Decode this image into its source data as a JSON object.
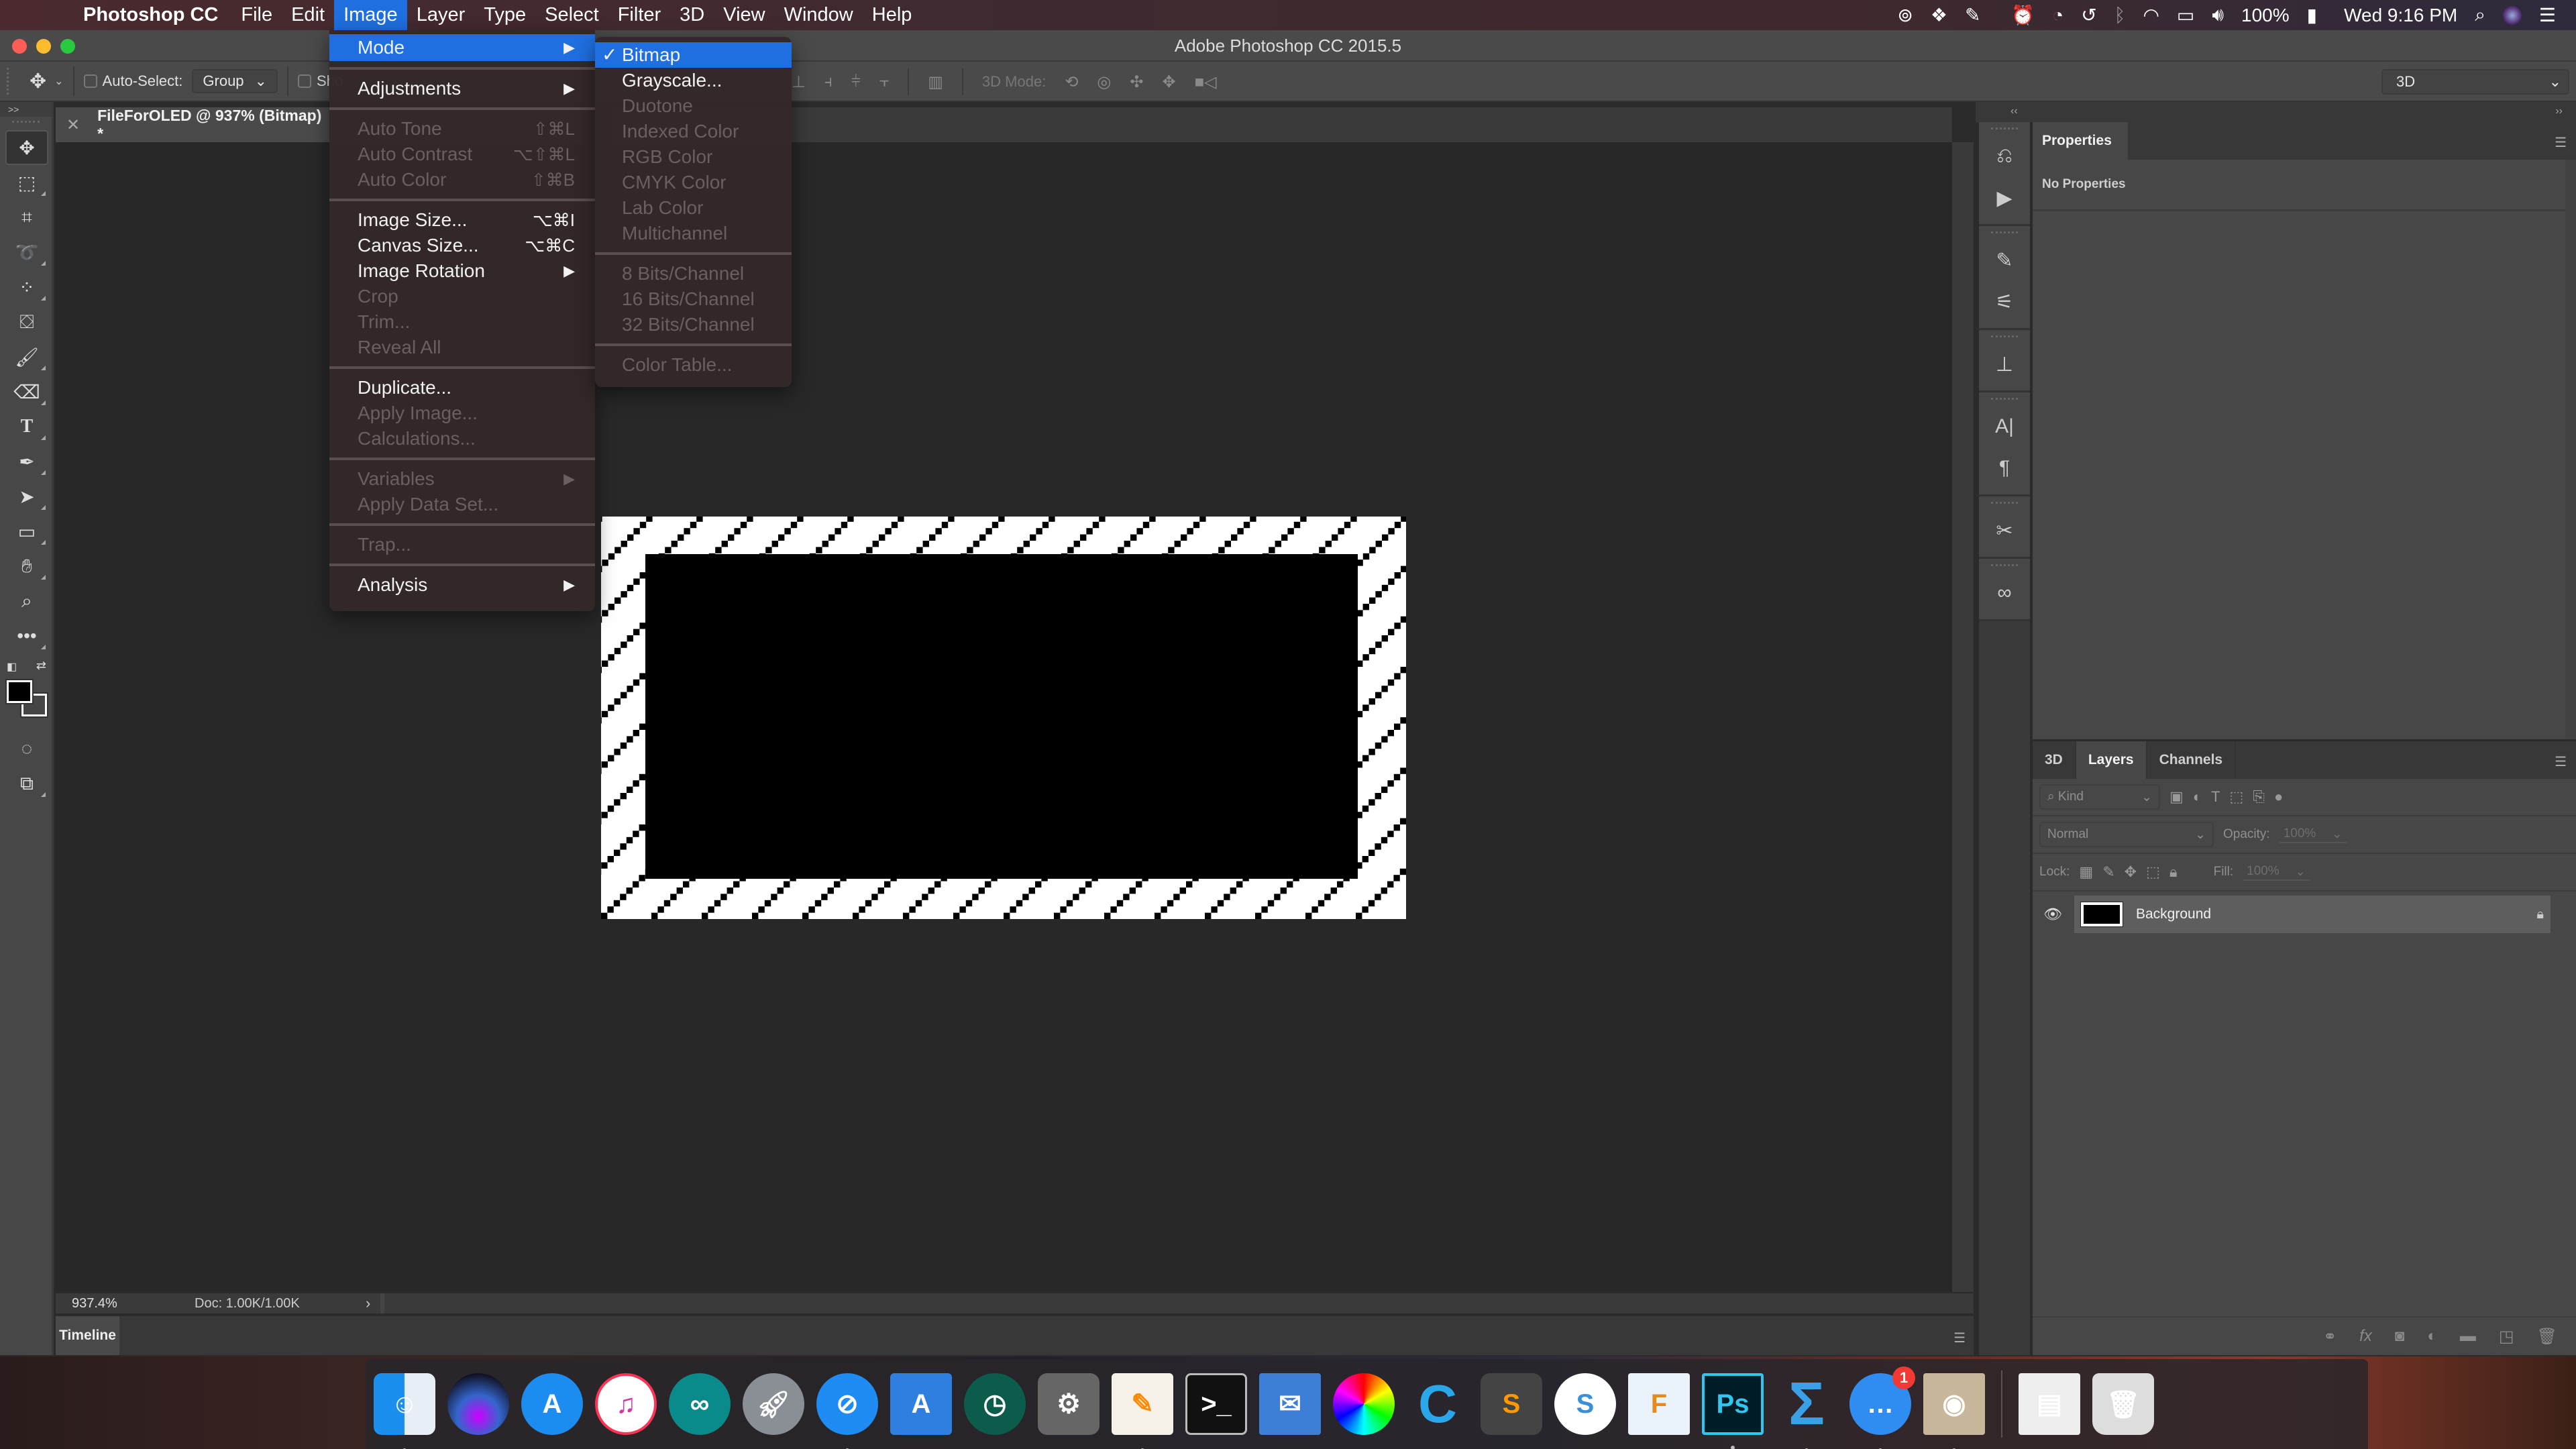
{
  "menubar": {
    "app_name": "Photoshop CC",
    "items": [
      "File",
      "Edit",
      "Image",
      "Layer",
      "Type",
      "Select",
      "Filter",
      "3D",
      "View",
      "Window",
      "Help"
    ],
    "active_item": "Image",
    "status": {
      "battery": "100%",
      "clock": "Wed 9:16 PM"
    }
  },
  "window": {
    "title": "Adobe Photoshop CC 2015.5"
  },
  "options_bar": {
    "auto_select_label": "Auto-Select:",
    "auto_select_checked": false,
    "auto_select_value": "Group",
    "show_transform_label": "Sho",
    "mode3d_label": "3D Mode:",
    "workspace": "3D"
  },
  "document": {
    "tab_title": "FileForOLED @ 937% (Bitmap) *",
    "zoom": "937.4%",
    "doc_info": "Doc: 1.00K/1.00K"
  },
  "timeline": {
    "label": "Timeline"
  },
  "image_menu": {
    "items": [
      {
        "label": "Mode",
        "submenu": true,
        "highlighted": true,
        "enabled": true
      },
      {
        "separator": true
      },
      {
        "label": "Adjustments",
        "submenu": true,
        "enabled": true
      },
      {
        "separator": true
      },
      {
        "label": "Auto Tone",
        "shortcut": "⇧⌘L",
        "enabled": false
      },
      {
        "label": "Auto Contrast",
        "shortcut": "⌥⇧⌘L",
        "enabled": false
      },
      {
        "label": "Auto Color",
        "shortcut": "⇧⌘B",
        "enabled": false
      },
      {
        "separator": true
      },
      {
        "label": "Image Size...",
        "shortcut": "⌥⌘I",
        "enabled": true
      },
      {
        "label": "Canvas Size...",
        "shortcut": "⌥⌘C",
        "enabled": true
      },
      {
        "label": "Image Rotation",
        "submenu": true,
        "enabled": true
      },
      {
        "label": "Crop",
        "enabled": false
      },
      {
        "label": "Trim...",
        "enabled": false
      },
      {
        "label": "Reveal All",
        "enabled": false
      },
      {
        "separator": true
      },
      {
        "label": "Duplicate...",
        "enabled": true
      },
      {
        "label": "Apply Image...",
        "enabled": false
      },
      {
        "label": "Calculations...",
        "enabled": false
      },
      {
        "separator": true
      },
      {
        "label": "Variables",
        "submenu": true,
        "enabled": false
      },
      {
        "label": "Apply Data Set...",
        "enabled": false
      },
      {
        "separator": true
      },
      {
        "label": "Trap...",
        "enabled": false
      },
      {
        "separator": true
      },
      {
        "label": "Analysis",
        "submenu": true,
        "enabled": true
      }
    ]
  },
  "mode_submenu": {
    "items": [
      {
        "label": "Bitmap",
        "checked": true,
        "highlighted": true,
        "enabled": true
      },
      {
        "label": "Grayscale...",
        "enabled": true
      },
      {
        "label": "Duotone",
        "enabled": false
      },
      {
        "label": "Indexed Color",
        "enabled": false
      },
      {
        "label": "RGB Color",
        "enabled": false
      },
      {
        "label": "CMYK Color",
        "enabled": false
      },
      {
        "label": "Lab Color",
        "enabled": false
      },
      {
        "label": "Multichannel",
        "enabled": false
      },
      {
        "separator": true
      },
      {
        "label": "8 Bits/Channel",
        "enabled": false
      },
      {
        "label": "16 Bits/Channel",
        "enabled": false
      },
      {
        "label": "32 Bits/Channel",
        "enabled": false
      },
      {
        "separator": true
      },
      {
        "label": "Color Table...",
        "enabled": false
      }
    ]
  },
  "properties_panel": {
    "title": "Properties",
    "empty_text": "No Properties"
  },
  "layers_panel": {
    "tabs": [
      "3D",
      "Layers",
      "Channels"
    ],
    "active_tab": "Layers",
    "filter_label": "Kind",
    "blend_mode": "Normal",
    "opacity_label": "Opacity:",
    "opacity_value": "100%",
    "lock_label": "Lock:",
    "fill_label": "Fill:",
    "fill_value": "100%",
    "layers": [
      {
        "name": "Background",
        "visible": true,
        "locked": true
      }
    ]
  },
  "dock": {
    "apps": [
      {
        "name": "Finder",
        "running": true
      },
      {
        "name": "Siri",
        "running": false
      },
      {
        "name": "App Store",
        "running": false
      },
      {
        "name": "iTunes",
        "running": false
      },
      {
        "name": "Arduino",
        "running": false
      },
      {
        "name": "Launchpad",
        "running": false
      },
      {
        "name": "Safari",
        "running": true
      },
      {
        "name": "Xcode",
        "running": false
      },
      {
        "name": "Time Machine",
        "running": false
      },
      {
        "name": "System Preferences",
        "running": false
      },
      {
        "name": "Pages",
        "running": true
      },
      {
        "name": "Terminal",
        "running": false
      },
      {
        "name": "Mail",
        "running": false
      },
      {
        "name": "Color Picker",
        "running": false
      },
      {
        "name": "Cura",
        "running": false
      },
      {
        "name": "Sublime Text",
        "running": false
      },
      {
        "name": "Simplenote",
        "running": false
      },
      {
        "name": "Fusion 360",
        "running": false
      },
      {
        "name": "Photoshop",
        "running": true
      },
      {
        "name": "Sigma",
        "running": true
      },
      {
        "name": "Messages",
        "running": true,
        "badge": "1"
      },
      {
        "name": "Preview",
        "running": true
      },
      {
        "name": "Documents",
        "running": false
      },
      {
        "name": "Trash",
        "running": false
      }
    ]
  }
}
